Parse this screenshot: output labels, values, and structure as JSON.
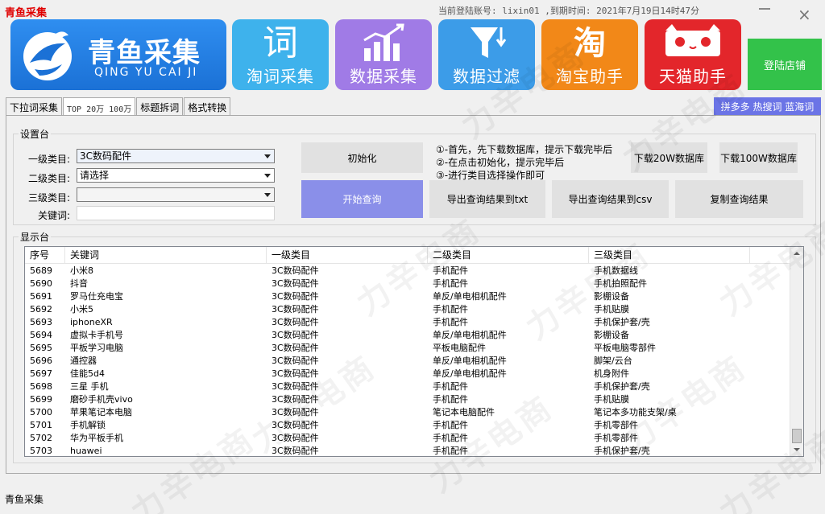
{
  "app": {
    "title": "青鱼采集",
    "account_info": "当前登陆账号: lixin01 ,到期时间: 2021年7月19日14时47分",
    "status": "青鱼采集"
  },
  "logo": {
    "cn": "青鱼采集",
    "en": "QING YU CAI JI"
  },
  "tiles": [
    {
      "label": "淘词采集",
      "icon": "ci-glyph-icon",
      "glyph": "词"
    },
    {
      "label": "数据采集",
      "icon": "bar-chart-icon"
    },
    {
      "label": "数据过滤",
      "icon": "funnel-icon"
    },
    {
      "label": "淘宝助手",
      "icon": "taobao-icon",
      "glyph": "淘"
    },
    {
      "label": "天猫助手",
      "icon": "tmall-icon"
    }
  ],
  "login_store": "登陆店铺",
  "tabs": [
    {
      "label": "下拉词采集"
    },
    {
      "label": "TOP 20万 100万"
    },
    {
      "label": "标题拆词"
    },
    {
      "label": "格式转换"
    }
  ],
  "quick_links": "拼多多 热搜词 蓝海词",
  "settings": {
    "title": "设置台",
    "cat1_label": "一级类目:",
    "cat1_value": "3C数码配件",
    "cat2_label": "二级类目:",
    "cat2_value": "请选择",
    "cat3_label": "三级类目:",
    "cat3_value": "",
    "keyword_label": "关键词:",
    "keyword_value": "",
    "init_button": "初始化",
    "start_button": "开始查询",
    "export_txt": "导出查询结果到txt",
    "export_csv": "导出查询结果到csv",
    "copy_button": "复制查询结果",
    "download_20w": "下载20W数据库",
    "download_100w": "下载100W数据库",
    "steps": [
      "①-首先，先下载数据库，提示下载完毕后",
      "②-在点击初始化，提示完毕后",
      "③-进行类目选择操作即可"
    ]
  },
  "display": {
    "title": "显示台",
    "columns": [
      "序号",
      "关键词",
      "一级类目",
      "二级类目",
      "三级类目"
    ],
    "rows": [
      [
        "5689",
        "小米8",
        "3C数码配件",
        "手机配件",
        "手机数据线"
      ],
      [
        "5690",
        "抖音",
        "3C数码配件",
        "手机配件",
        "手机拍照配件"
      ],
      [
        "5691",
        "罗马仕充电宝",
        "3C数码配件",
        "单反/单电相机配件",
        "影棚设备"
      ],
      [
        "5692",
        "小米5",
        "3C数码配件",
        "手机配件",
        "手机贴膜"
      ],
      [
        "5693",
        "iphoneXR",
        "3C数码配件",
        "手机配件",
        "手机保护套/壳"
      ],
      [
        "5694",
        "虚拟卡手机号",
        "3C数码配件",
        "单反/单电相机配件",
        "影棚设备"
      ],
      [
        "5695",
        "平板学习电脑",
        "3C数码配件",
        "平板电脑配件",
        "平板电脑零部件"
      ],
      [
        "5696",
        "通控器",
        "3C数码配件",
        "单反/单电相机配件",
        "脚架/云台"
      ],
      [
        "5697",
        "佳能5d4",
        "3C数码配件",
        "单反/单电相机配件",
        "机身附件"
      ],
      [
        "5698",
        "三星 手机",
        "3C数码配件",
        "手机配件",
        "手机保护套/壳"
      ],
      [
        "5699",
        "磨砂手机壳vivo",
        "3C数码配件",
        "手机配件",
        "手机贴膜"
      ],
      [
        "5700",
        "苹果笔记本电脑",
        "3C数码配件",
        "笔记本电脑配件",
        "笔记本多功能支架/桌"
      ],
      [
        "5701",
        "手机解锁",
        "3C数码配件",
        "手机配件",
        "手机零部件"
      ],
      [
        "5702",
        "华为平板手机",
        "3C数码配件",
        "手机配件",
        "手机零部件"
      ],
      [
        "5703",
        "huawei",
        "3C数码配件",
        "手机配件",
        "手机保护套/壳"
      ]
    ]
  },
  "watermark": "力辛电商"
}
